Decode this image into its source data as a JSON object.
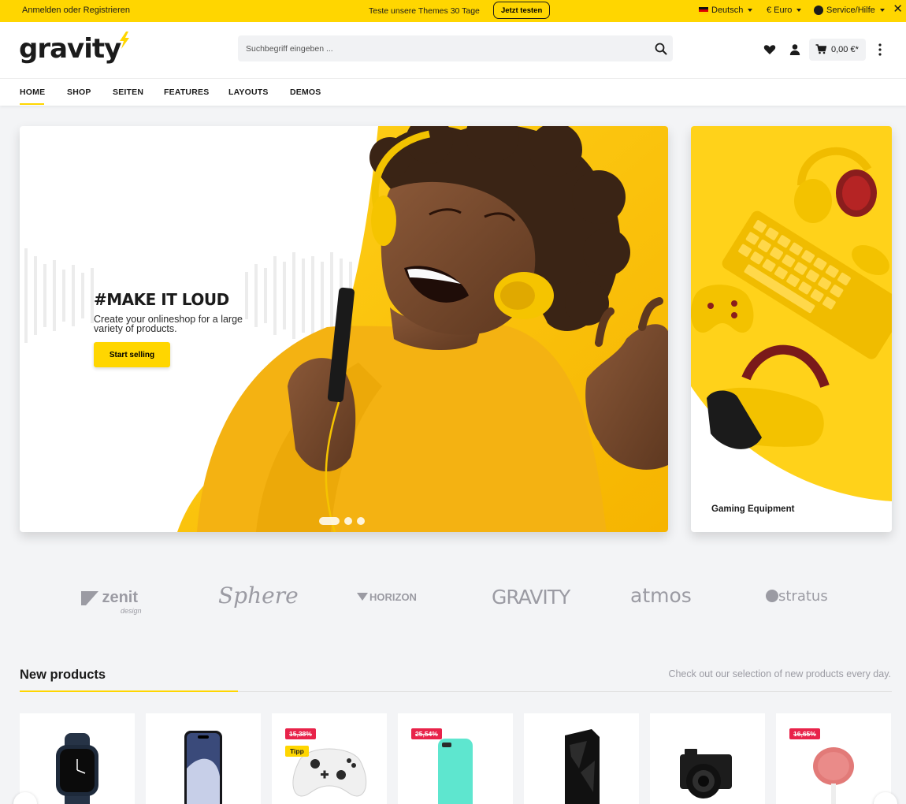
{
  "topbar": {
    "login_text": "Anmelden oder Registrieren",
    "promo_text": "Teste unsere Themes 30 Tage",
    "promo_button": "Jetzt testen",
    "language": "Deutsch",
    "currency": "€ Euro",
    "service": "Service/Hilfe",
    "close": "✕"
  },
  "header": {
    "logo": "gravity",
    "search_placeholder": "Suchbegriff eingeben ...",
    "cart_total": "0,00 €*"
  },
  "nav": {
    "items": [
      "HOME",
      "SHOP",
      "SEITEN",
      "FEATURES",
      "LAYOUTS",
      "DEMOS"
    ],
    "active": "HOME"
  },
  "hero": {
    "headline": "#MAKE IT LOUD",
    "subline_1": "Create your onlineshop for a large",
    "subline_2": "variety of products.",
    "cta": "Start selling",
    "slides": 3,
    "active_slide": 1
  },
  "side_banner": {
    "label": "Gaming Equipment"
  },
  "brands": [
    "zenit",
    "design",
    "Sphere",
    "HORIZON",
    "GRAVITY",
    "atmos",
    "stratus"
  ],
  "new_products": {
    "title": "New products",
    "subtitle": "Check out our selection of new products every day.",
    "items": [
      {
        "name": "smartwatch",
        "badge": ""
      },
      {
        "name": "smartphone",
        "badge": ""
      },
      {
        "name": "game-controller",
        "badge": "15,38%",
        "tag": "Tipp"
      },
      {
        "name": "phone-case",
        "badge": "25,54%"
      },
      {
        "name": "pc-tower",
        "badge": ""
      },
      {
        "name": "camera",
        "badge": ""
      },
      {
        "name": "smart-speaker",
        "badge": "16,65%"
      }
    ]
  },
  "colors": {
    "accent": "#ffd600",
    "sale": "#e8234a",
    "text": "#1b1b1b",
    "muted": "#9b9ba3",
    "page_bg": "#f3f4f6"
  }
}
